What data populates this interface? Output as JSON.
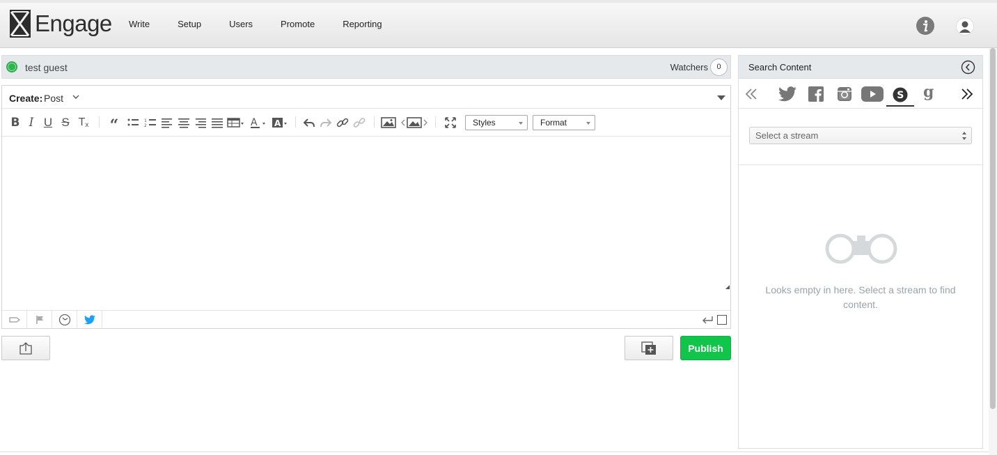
{
  "app": {
    "logo_text": "Engage"
  },
  "nav": {
    "items": [
      "Write",
      "Setup",
      "Users",
      "Promote",
      "Reporting"
    ]
  },
  "header_icons": [
    "info-icon",
    "user-icon"
  ],
  "guest": {
    "name": "test guest",
    "status_color": "#29b84a",
    "watchers_label": "Watchers",
    "watchers_count": "0"
  },
  "composer": {
    "create_label": "Create:",
    "create_value": "Post",
    "toolbar": {
      "styles_label": "Styles",
      "format_label": "Format"
    },
    "publish_label": "Publish",
    "publish_color": "#10c54a"
  },
  "search_panel": {
    "title": "Search Content",
    "sources": [
      "twitter-icon",
      "facebook-icon",
      "instagram-icon",
      "youtube-icon",
      "scribblelive-icon",
      "g-icon"
    ],
    "active_source": "scribblelive-icon",
    "stream_placeholder": "Select a stream",
    "empty_message": "Looks empty in here. Select a stream to find content."
  }
}
